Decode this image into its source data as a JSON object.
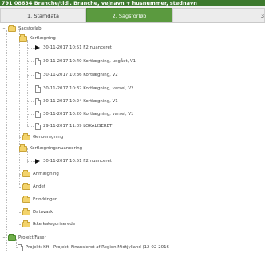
{
  "title": "791 08634 Branche/tidl. Branche, vejnavn + husnummer, stednavn",
  "tabs": [
    {
      "label": "1. Stamdata",
      "active": false
    },
    {
      "label": "2. Sagsforløb",
      "active": true
    },
    {
      "label": "3",
      "active": false
    }
  ],
  "tree": {
    "root": "Sagsforløb",
    "kortlaegning": {
      "label": "Kortlægning",
      "items": [
        {
          "text": "30-11-2017 10:51 F2 nuanceret",
          "type": "current"
        },
        {
          "text": "30-11-2017 10:40 Kortlægning, udgået, V1",
          "type": "doc"
        },
        {
          "text": "30-11-2017 10:36 Kortlægning, V2",
          "type": "doc"
        },
        {
          "text": "30-11-2017 10:32 Kortlægning, varsel, V2",
          "type": "doc"
        },
        {
          "text": "30-11-2017 10:24 Kortlægning, V1",
          "type": "doc"
        },
        {
          "text": "30-11-2017 10:20 Kortlægning, varsel, V1",
          "type": "doc"
        },
        {
          "text": "29-11-2017 11:09 LOKALISERET",
          "type": "doc"
        }
      ]
    },
    "genberegning": "Genberegning",
    "nuancering": {
      "label": "Kortlægningsnuancering",
      "items": [
        {
          "text": "30-11-2017 10:51 F2 nuanceret",
          "type": "current"
        }
      ]
    },
    "other_folders": [
      "Anmægning",
      "Andet",
      "Erindringer",
      "Datavask",
      "Ikke kategoriserede"
    ],
    "projekt": {
      "label": "Projekt/Faser",
      "items": [
        {
          "text": "Projekt: Kft - Projekt, Finansieret af Region Midtjylland (12-02-2016 -",
          "type": "doc"
        }
      ]
    }
  }
}
